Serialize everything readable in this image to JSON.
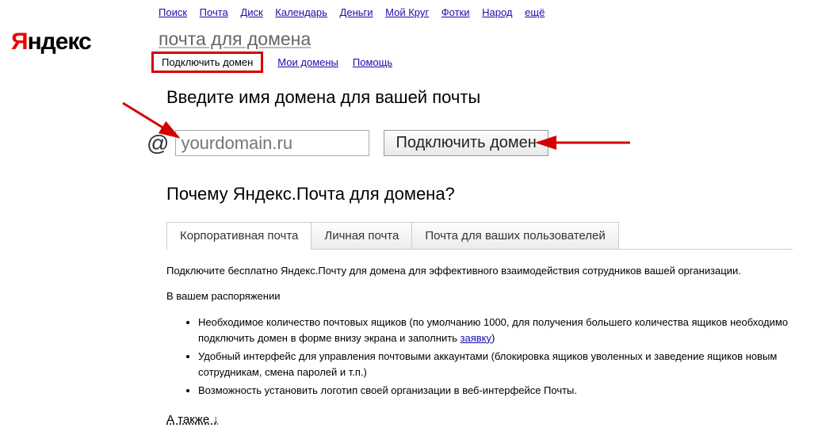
{
  "logo": {
    "y": "Я",
    "rest": "ндекс"
  },
  "header_nav": {
    "items": [
      "Поиск",
      "Почта",
      "Диск",
      "Календарь",
      "Деньги",
      "Мой Круг",
      "Фотки",
      "Народ",
      "ещё"
    ]
  },
  "page_title": "почта для домена",
  "main_tabs": {
    "active": "Подключить домен",
    "links": [
      "Мои домены",
      "Помощь"
    ]
  },
  "heading": "Введите имя домена для вашей почты",
  "at": "@",
  "domain_input_placeholder": "yourdomain.ru",
  "connect_label": "Подключить домен",
  "why_heading": "Почему Яндекс.Почта для домена?",
  "feature_tabs": {
    "items": [
      "Корпоративная почта",
      "Личная почта",
      "Почта для ваших пользователей"
    ],
    "active_index": 0
  },
  "desc": {
    "p1": "Подключите бесплатно Яндекс.Почту для домена для эффективного взаимодействия сотрудников вашей организации.",
    "p2": "В вашем распоряжении",
    "li1_a": "Необходимое количество почтовых ящиков (по умолчанию 1000, для получения большего количества ящиков необходимо подключить домен в форме внизу экрана и заполнить ",
    "li1_link": "заявку",
    "li1_b": ")",
    "li2": "Удобный интерфейс для управления почтовыми аккаунтами (блокировка ящиков уволенных и заведение ящиков новым сотрудникам, смена паролей и т.п.)",
    "li3": "Возможность установить логотип своей организации в веб-интерфейсе Почты."
  },
  "also": "А также ↓"
}
